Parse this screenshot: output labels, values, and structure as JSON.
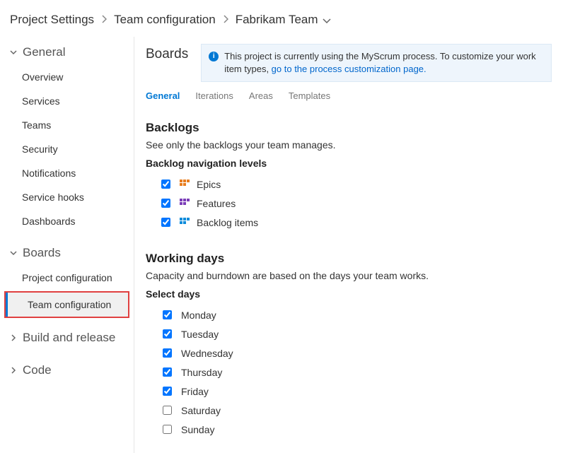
{
  "breadcrumb": {
    "root": "Project Settings",
    "mid": "Team configuration",
    "current": "Fabrikam Team"
  },
  "sidebar": {
    "sections": [
      {
        "title": "General",
        "expanded": true,
        "items": [
          {
            "label": "Overview"
          },
          {
            "label": "Services"
          },
          {
            "label": "Teams"
          },
          {
            "label": "Security"
          },
          {
            "label": "Notifications"
          },
          {
            "label": "Service hooks"
          },
          {
            "label": "Dashboards"
          }
        ]
      },
      {
        "title": "Boards",
        "expanded": true,
        "items": [
          {
            "label": "Project configuration"
          },
          {
            "label": "Team configuration"
          }
        ]
      },
      {
        "title": "Build and release",
        "expanded": false,
        "items": []
      },
      {
        "title": "Code",
        "expanded": false,
        "items": []
      }
    ]
  },
  "main": {
    "title": "Boards",
    "banner": {
      "text": "This project is currently using the MyScrum process. To customize your work item types, ",
      "link": "go to the process customization page."
    },
    "tabs": [
      {
        "label": "General",
        "active": true
      },
      {
        "label": "Iterations"
      },
      {
        "label": "Areas"
      },
      {
        "label": "Templates"
      }
    ],
    "backlogs": {
      "heading": "Backlogs",
      "desc": "See only the backlogs your team manages.",
      "nav_label": "Backlog navigation levels",
      "levels": [
        {
          "label": "Epics",
          "checked": true,
          "icon": "wi-epics"
        },
        {
          "label": "Features",
          "checked": true,
          "icon": "wi-features"
        },
        {
          "label": "Backlog items",
          "checked": true,
          "icon": "wi-backlog"
        }
      ]
    },
    "working_days": {
      "heading": "Working days",
      "desc": "Capacity and burndown are based on the days your team works.",
      "select_label": "Select days",
      "days": [
        {
          "label": "Monday",
          "checked": true
        },
        {
          "label": "Tuesday",
          "checked": true
        },
        {
          "label": "Wednesday",
          "checked": true
        },
        {
          "label": "Thursday",
          "checked": true
        },
        {
          "label": "Friday",
          "checked": true
        },
        {
          "label": "Saturday",
          "checked": false
        },
        {
          "label": "Sunday",
          "checked": false
        }
      ]
    }
  }
}
